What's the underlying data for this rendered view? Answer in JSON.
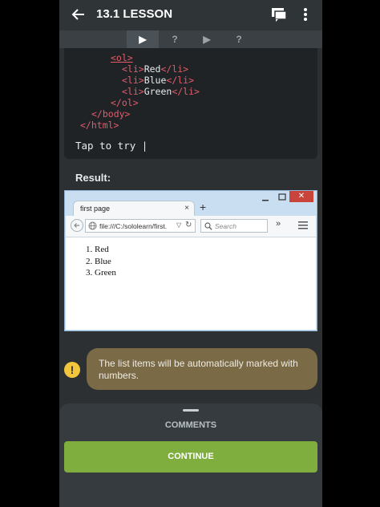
{
  "header": {
    "title": "13.1 LESSON"
  },
  "steps": [
    "▶",
    "?",
    "▶",
    "?"
  ],
  "code": {
    "lines": [
      {
        "pre": "   ",
        "open": "<ol>",
        "text": "",
        "close": ""
      },
      {
        "pre": "     ",
        "open": "<li>",
        "text": "Red",
        "close": "</li>"
      },
      {
        "pre": "     ",
        "open": "<li>",
        "text": "Blue",
        "close": "</li>"
      },
      {
        "pre": "     ",
        "open": "<li>",
        "text": "Green",
        "close": "</li>"
      },
      {
        "pre": "   ",
        "open": "</ol>",
        "text": "",
        "close": ""
      },
      {
        "pre": "  ",
        "open": "</body>",
        "text": "",
        "close": ""
      },
      {
        "pre": "",
        "open": "</html>",
        "text": "",
        "close": ""
      }
    ],
    "tap_prompt": "Tap to try |"
  },
  "result_label": "Result:",
  "browser": {
    "tab_title": "first page",
    "tab_close": "×",
    "new_tab": "+",
    "url": "file:///C:/sololearn/first.",
    "search_placeholder": "Search",
    "overflow": "»",
    "list": [
      "Red",
      "Blue",
      "Green"
    ],
    "close_glyph": "✕"
  },
  "tip": {
    "text": "The list items will be automatically marked with numbers.",
    "icon": "!"
  },
  "bottom": {
    "comments_label": "COMMENTS",
    "continue_label": "CONTINUE"
  }
}
